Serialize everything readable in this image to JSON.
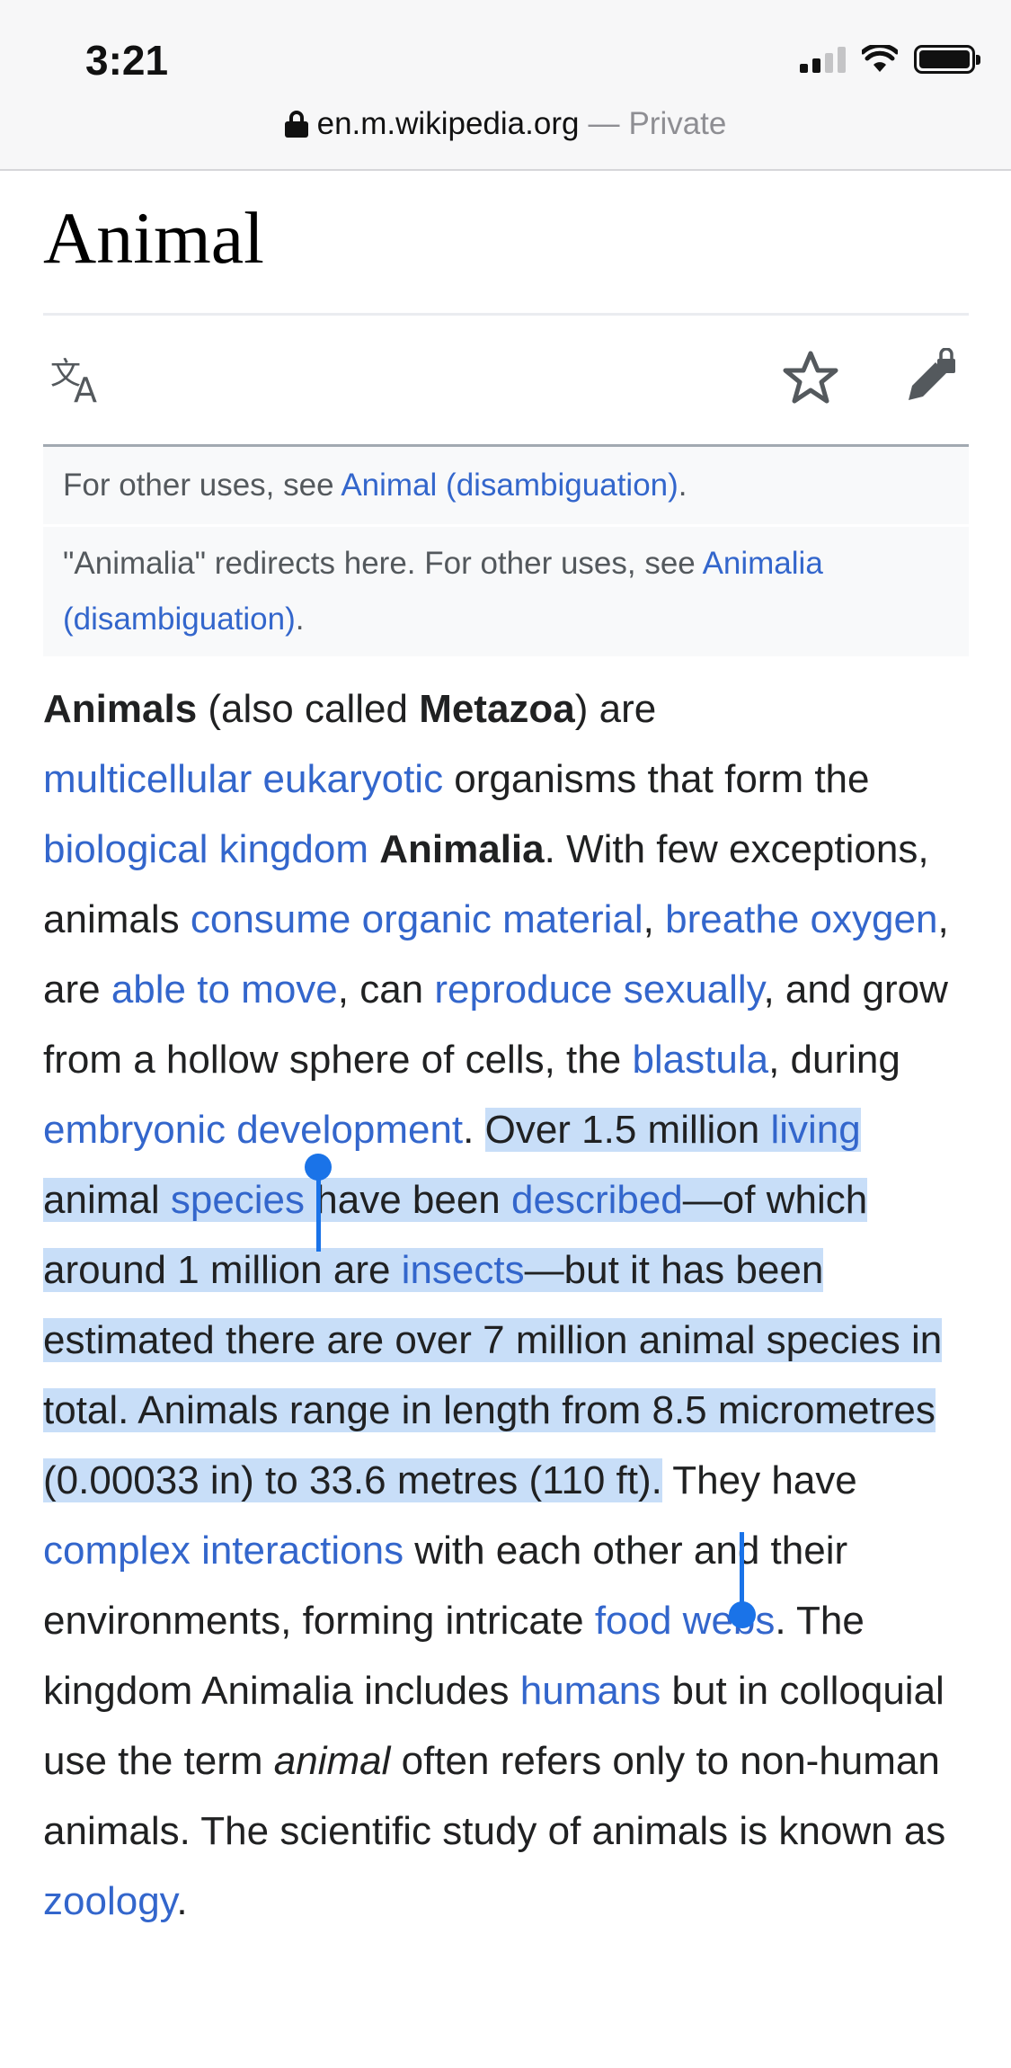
{
  "status_bar": {
    "time": "3:21",
    "icons": [
      "cellular-signal-icon",
      "wifi-icon",
      "battery-icon"
    ]
  },
  "url_bar": {
    "domain": "en.m.wikipedia.org",
    "separator": "—",
    "mode": "Private"
  },
  "article": {
    "title": "Animal",
    "actions": [
      "language-icon",
      "star-icon",
      "edit-locked-icon"
    ],
    "hatnote_1": {
      "prefix": "For other uses, see ",
      "link": "Animal (disambiguation)",
      "suffix": "."
    },
    "hatnote_2": {
      "prefix": "\"Animalia\" redirects here. For other uses, see ",
      "link": "Animalia (disambiguation)",
      "suffix": "."
    },
    "lead": {
      "t1": "Animals",
      "t2": " (also called ",
      "t3": "Metazoa",
      "t4": ") are ",
      "l1": "multicellular",
      "t5": " ",
      "l2": "eukaryotic",
      "t6": " organisms that form the ",
      "l3": "biological kingdom",
      "t7": " ",
      "t8": "Animalia",
      "t9": ". With few exceptions, animals ",
      "l4": "consume organic material",
      "t10": ", ",
      "l5": "breathe oxygen",
      "t11": ", are ",
      "l6": "able to move",
      "t12": ", can ",
      "l7": "reproduce sexually",
      "t13": ", and grow from a hollow sphere of cells, the ",
      "l8": "blastula",
      "t14": ", during ",
      "l9": "embryonic development",
      "t15": ". ",
      "s1": "Over 1.5 million ",
      "sl1": "living",
      "s2": " animal ",
      "sl2": "species",
      "s3": " have been ",
      "sl3": "described",
      "s4": "—of which around 1 million are ",
      "sl4": "insects",
      "s5": "—but it has been estimated there are over 7 million animal species in total. Animals range in length from 8.5 micrometres (0.00033 in) to 33.6 metres (110 ft).",
      "t16": " They have ",
      "l10": "complex interactions",
      "t17": " with each other and their environments, forming intricate ",
      "l11": "food webs",
      "t18": ". The kingdom Animalia includes ",
      "l12": "humans",
      "t19": " but in colloquial use the term ",
      "t20": "animal",
      "t21": " often refers only to non-human animals. The scientific study of animals is known as ",
      "l13": "zoology",
      "t22": "."
    }
  },
  "colors": {
    "link": "#3366cc",
    "selection": "#c8def8",
    "selection_handle": "#1a73e8"
  }
}
